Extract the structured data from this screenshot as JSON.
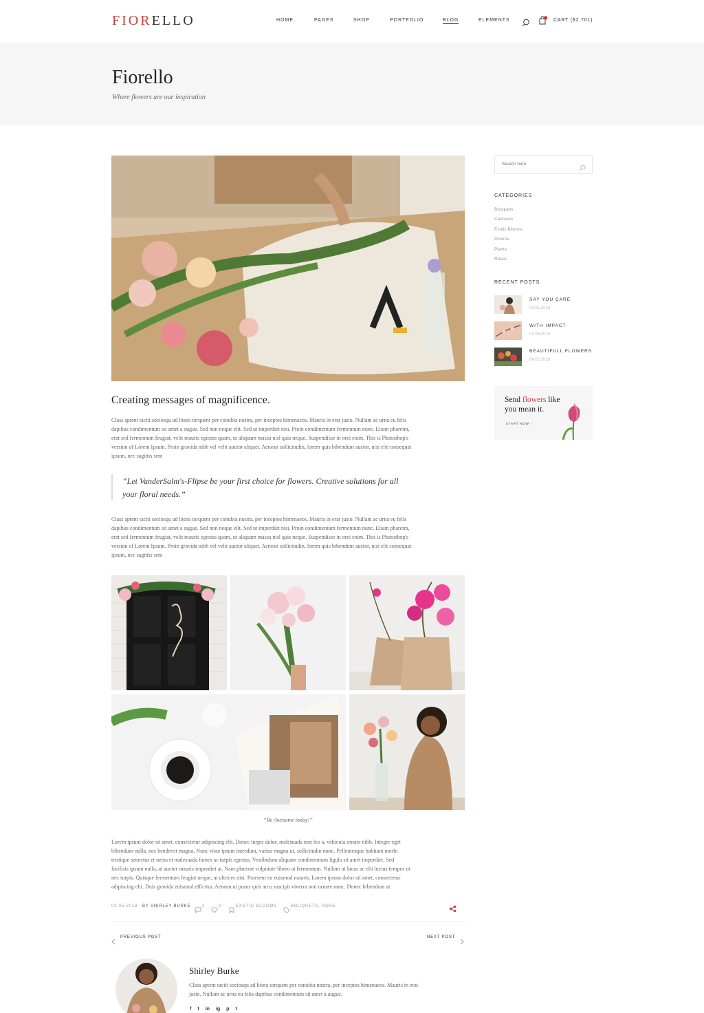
{
  "header": {
    "logo_accent": "FIOR",
    "logo_rest": "ELLO",
    "nav": [
      "HOME",
      "PAGES",
      "SHOP",
      "PORTFOLIO",
      "BLOG",
      "ELEMENTS"
    ],
    "active_nav": "BLOG",
    "cart_label": "CART ($2,701)",
    "search_icon": "search-icon",
    "cart_icon": "bag-icon"
  },
  "banner": {
    "title": "Fiorello",
    "subtitle": "Where flowers are our inspiration"
  },
  "post": {
    "title": "Creating messages of magnificence.",
    "para1": [
      "Class aptent taciti sociosqu ad litora torquent per conubia nostra, per inceptos himenaeos. Mauris in erat justo. Nullam ac urna eu felis",
      "dapibus condimentum sit amet a augue. Sed non neque elit. Sed ut imperdiet nisi. Proin condimentum fermentum nunc. Etiam pharetra,",
      "erat sed fermentum feugiat, velit mauris egestas quam, ut aliquam massa nisl quis neque. Suspendisse in orci enim. This is Photoshop's",
      "version of Lorem Ipsum. Proin gravida nibh vel velit auctor aliquet. Aenean sollicitudin, lorem quis bibendum auctor, nisi elit consequat",
      "ipsum, nec sagittis sem"
    ],
    "quote_line1": "“Let VanderSalm's-Flipse be your first choice for flowers. Creative solutions for all",
    "quote_line2": "your floral needs.”",
    "para2": [
      "Class aptent taciti sociosqu ad litora torquent per conubia nostra, per inceptos himenaeos. Mauris in erat justo. Nullam ac urna eu felis",
      "dapibus condimentum sit amet a augue. Sed non neque elit. Sed ut imperdiet nisi. Proin condimentum fermentum nunc. Etiam pharetra,",
      "erat sed fermentum feugiat, velit mauris egestas quam, ut aliquam massa nisl quis neque. Suspendisse in orci enim. This is Photoshop's",
      "version of Lorem Ipsum. Proin gravida nibh vel velit auctor aliquet. Aenean sollicitudin, lorem quis bibendum auctor, nisi elit consequat",
      "ipsum, nec sagittis sem"
    ],
    "gallery_caption": "“Be Awesome today!”",
    "para3": [
      "Lorem ipsum dolor sit amet, consectetur adipiscing elit. Donec turpis dolor, malesuada non leo a, vehicula ornare nibh. Integer eget",
      "bibendum nulla, nec hendrerit magna. Nunc vitae ipsum interdum, varius magna ut, sollicitudin nunc. Pellentesque habitant morbi",
      "tristique senectus et netus et malesuada fames ac turpis egestas. Vestibulum aliquam condimentum ligula sit amet imperdiet. Sed",
      "facilisis ipsum nulla, at auctor mauris imperdiet at. Nam placerat vulputate libero at fermentum. Nullam ut lacus ac elit luctus tempor ut",
      "nec turpis. Quisque fermentum feugiat neque, ut ultrices nisi. Praesent eu euismod mauris. Lorem ipsum dolor sit amet, consectetur",
      "adipiscing elit. Duis gravida euismod efficitur. Aenean ut purus quis arcu suscipit viverra non ornare nunc. Donec bibendum at"
    ],
    "meta": {
      "date": "03.05.2018",
      "author": "BY SHIRLEY BURKE",
      "comments": "2",
      "likes": "0",
      "category": "EXOTIC BLOOMS",
      "tags": "BOUQUETS, ROSE"
    },
    "prev_label": "PREVIOUS POST",
    "next_label": "NEXT POST"
  },
  "author": {
    "name": "Shirley Burke",
    "bio_line1": "Class aptent taciti sociosqu ad litora torquent per conubia nostra, per inceptos himenaeos. Mauris in erat",
    "bio_line2": "justo. Nullam ac urna eu felis dapibus condimentum sit amet a augue.",
    "social_icons": [
      "f",
      "t",
      "in",
      "ig",
      "p",
      "t"
    ]
  },
  "sidebar": {
    "search_placeholder": "Search here",
    "categories_title": "CATEGORIES",
    "categories": [
      "Bouquets",
      "Cactuses",
      "Exotic Blooms",
      "Greens",
      "Plants",
      "Roses"
    ],
    "recent_title": "RECENT POSTS",
    "recent": [
      {
        "title": "SAY YOU CARE",
        "date": "04.05.2018"
      },
      {
        "title": "WITH IMPACT",
        "date": "04.05.2018"
      },
      {
        "title": "BEAUTIFULL FLOWERS",
        "date": "04.05.2018"
      }
    ],
    "promo_line1_a": "Send ",
    "promo_line1_b": "flowers",
    "promo_line1_c": " like",
    "promo_line2": "you mean it.",
    "promo_cta": "START NOW"
  },
  "colors": {
    "accent": "#c9403f",
    "banner_bg": "#f6f6f6"
  }
}
